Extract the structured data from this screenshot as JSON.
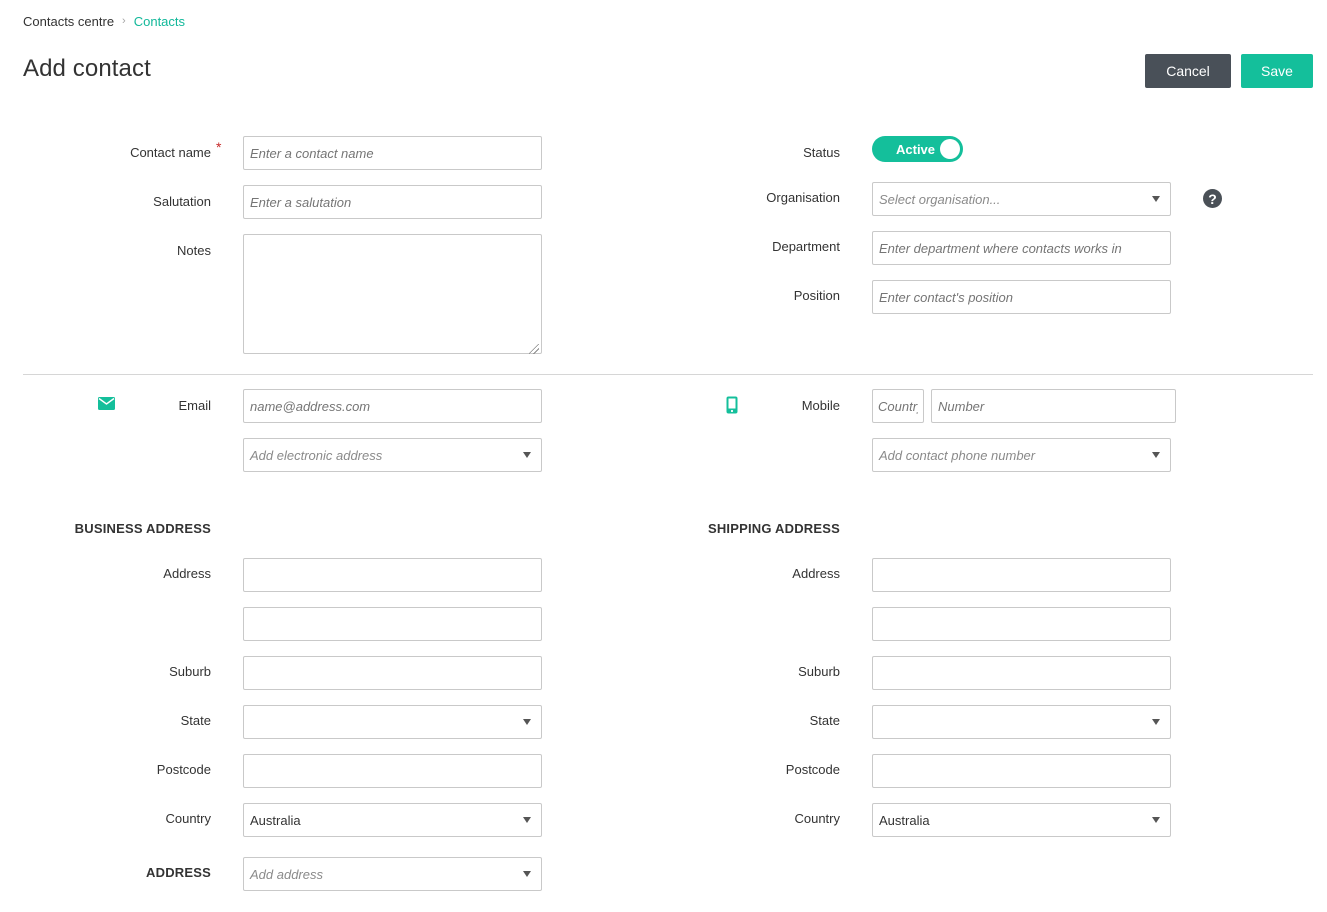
{
  "breadcrumb": {
    "root": "Contacts centre",
    "separator": "›",
    "current": "Contacts"
  },
  "page": {
    "title": "Add contact"
  },
  "actions": {
    "cancel": "Cancel",
    "save": "Save"
  },
  "left_form": {
    "contact_name": {
      "label": "Contact name",
      "required_mark": "*",
      "placeholder": "Enter a contact name",
      "value": ""
    },
    "salutation": {
      "label": "Salutation",
      "placeholder": "Enter a salutation",
      "value": ""
    },
    "notes": {
      "label": "Notes",
      "value": ""
    }
  },
  "right_form": {
    "status": {
      "label": "Status",
      "value": "Active",
      "on": true
    },
    "organisation": {
      "label": "Organisation",
      "placeholder": "Select organisation..."
    },
    "department": {
      "label": "Department",
      "placeholder": "Enter department where contacts works in"
    },
    "position": {
      "label": "Position",
      "placeholder": "Enter contact's position"
    }
  },
  "email": {
    "icon": "envelope-icon",
    "label": "Email",
    "placeholder": "name@address.com",
    "add_placeholder": "Add electronic address"
  },
  "mobile": {
    "icon": "mobile-phone-icon",
    "label": "Mobile",
    "country_placeholder": "Country",
    "number_placeholder": "Number",
    "add_placeholder": "Add contact phone number"
  },
  "business_address": {
    "heading": "BUSINESS ADDRESS",
    "address_label": "Address",
    "suburb_label": "Suburb",
    "state_label": "State",
    "postcode_label": "Postcode",
    "country_label": "Country",
    "country_value": "Australia"
  },
  "shipping_address": {
    "heading": "SHIPPING ADDRESS",
    "address_label": "Address",
    "suburb_label": "Suburb",
    "state_label": "State",
    "postcode_label": "Postcode",
    "country_label": "Country",
    "country_value": "Australia"
  },
  "extra_address": {
    "label": "ADDRESS",
    "placeholder": "Add address"
  },
  "help_icon": "question-circle-icon",
  "colors": {
    "accent": "#14bf9b",
    "cancel_button": "#495058",
    "required": "#c62828"
  }
}
